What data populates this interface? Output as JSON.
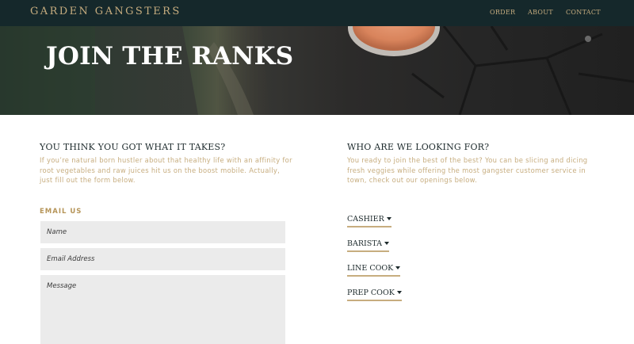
{
  "nav": {
    "brand": "GARDEN GANGSTERS",
    "links": [
      {
        "label": "ORDER"
      },
      {
        "label": "ABOUT"
      },
      {
        "label": "CONTACT"
      }
    ]
  },
  "hero": {
    "title": "JOIN THE RANKS"
  },
  "apply": {
    "heading": "YOU THINK YOU GOT WHAT IT TAKES?",
    "body": "If you’re natural born hustler about that healthy life with an affinity for root vegetables and raw juices hit us on the boost mobile. Actually, just fill out the form below.",
    "email_label": "EMAIL US",
    "fields": {
      "name_placeholder": "Name",
      "email_placeholder": "Email Address",
      "message_placeholder": "Message"
    }
  },
  "looking": {
    "heading": "WHO ARE WE LOOKING FOR?",
    "body": "You ready to join the best of the best? You can be slicing and dicing fresh veggies while offering the most gangster customer service in town, check out our openings below.",
    "jobs": [
      {
        "label": "CASHIER"
      },
      {
        "label": "BARISTA"
      },
      {
        "label": "LINE COOK"
      },
      {
        "label": "PREP COOK"
      }
    ]
  },
  "colors": {
    "nav_bg": "#15282b",
    "accent_gold": "#c7ad7f",
    "heading_dark": "#1d2a2c",
    "field_bg": "#ebebeb"
  }
}
